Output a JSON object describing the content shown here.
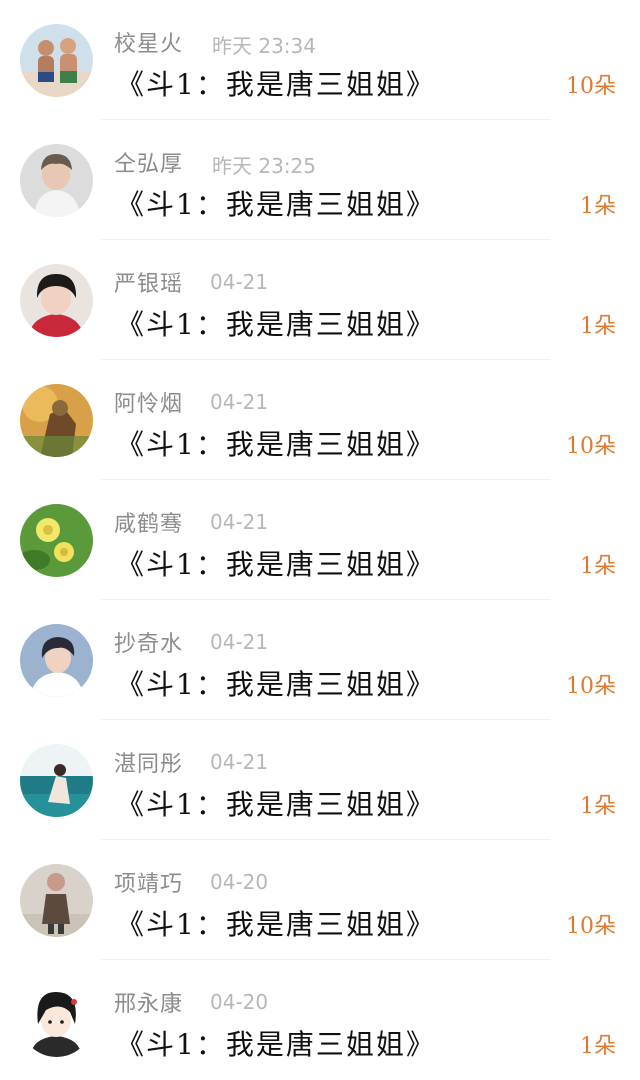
{
  "gift_records": [
    {
      "name": "校星火",
      "time": "昨天 23:34",
      "message": "《斗1：我是唐三姐姐》",
      "gift_count": "10朵"
    },
    {
      "name": "仝弘厚",
      "time": "昨天 23:25",
      "message": "《斗1：我是唐三姐姐》",
      "gift_count": "1朵"
    },
    {
      "name": "严银瑶",
      "time": "04-21",
      "message": "《斗1：我是唐三姐姐》",
      "gift_count": "1朵"
    },
    {
      "name": "阿怜烟",
      "time": "04-21",
      "message": "《斗1：我是唐三姐姐》",
      "gift_count": "10朵"
    },
    {
      "name": "咸鹤骞",
      "time": "04-21",
      "message": "《斗1：我是唐三姐姐》",
      "gift_count": "1朵"
    },
    {
      "name": "抄奇水",
      "time": "04-21",
      "message": "《斗1：我是唐三姐姐》",
      "gift_count": "10朵"
    },
    {
      "name": "湛同彤",
      "time": "04-21",
      "message": "《斗1：我是唐三姐姐》",
      "gift_count": "1朵"
    },
    {
      "name": "项靖巧",
      "time": "04-20",
      "message": "《斗1：我是唐三姐姐》",
      "gift_count": "10朵"
    },
    {
      "name": "邢永康",
      "time": "04-20",
      "message": "《斗1：我是唐三姐姐》",
      "gift_count": "1朵"
    }
  ],
  "colors": {
    "name": "#8c8c8c",
    "time": "#b7b7b7",
    "message": "#111111",
    "gift_count": "#e0792f"
  }
}
